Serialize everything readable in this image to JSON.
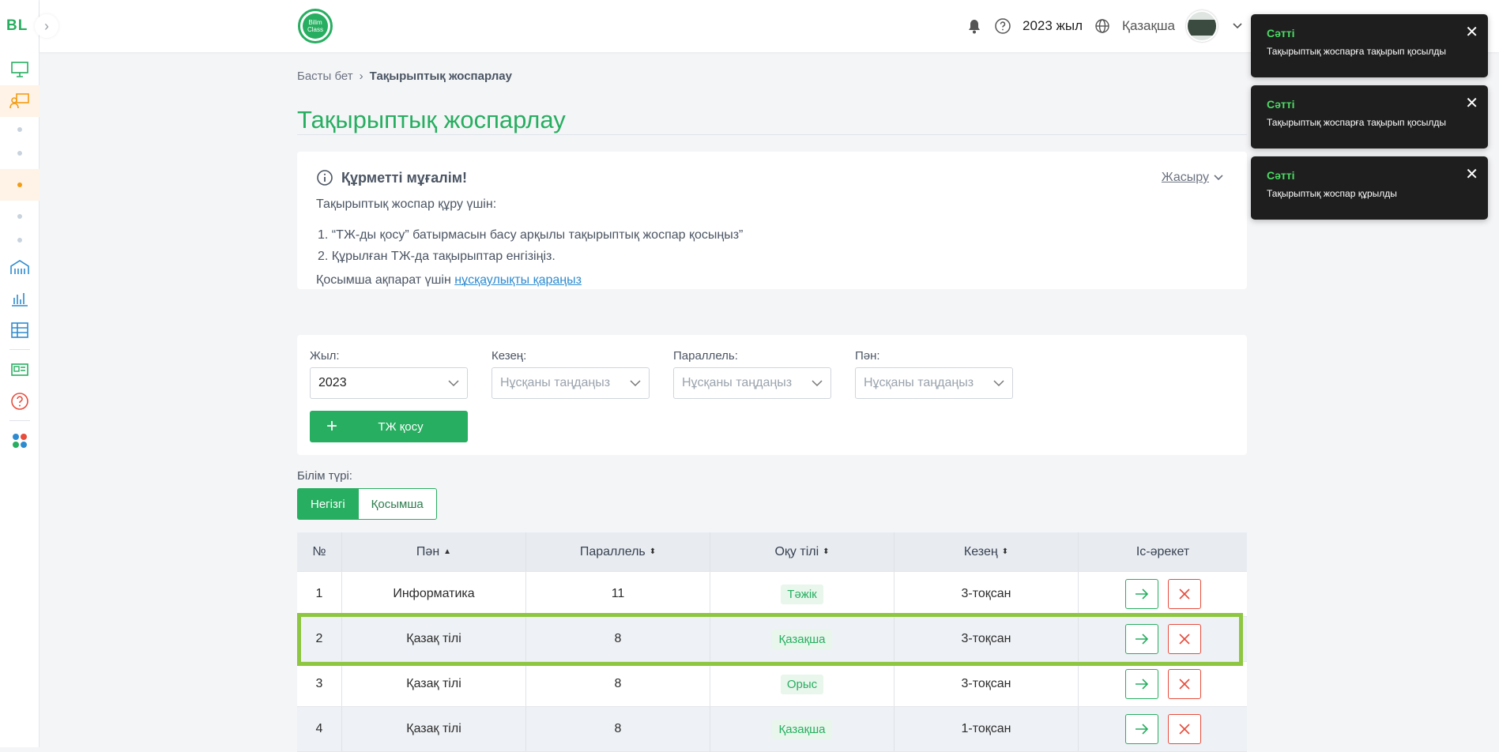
{
  "sidebar": {
    "logo": "BL",
    "collapse_icon": "chevron-right-icon"
  },
  "topbar": {
    "brand_text": "Bilim Class",
    "year": "2023 жыл",
    "language": "Қазақша"
  },
  "breadcrumb": {
    "home": "Басты бет",
    "current": "Тақырыптық жоспарлау"
  },
  "page_title": "Тақырыптық жоспарлау",
  "info": {
    "heading": "Құрметті мұғалім!",
    "hide_label": "Жасыру",
    "intro": "Тақырыптық жоспар құру үшін:",
    "steps": [
      "1. “ТЖ-ды қосу” батырмасын басу арқылы тақырыптық жоспар қосыңыз”",
      "2. Құрылған ТЖ-да тақырыптар енгізіңіз."
    ],
    "more_prefix": "Қосымша ақпарат үшін ",
    "more_link": "нұсқаулықты қараңыз"
  },
  "filters": {
    "year_label": "Жыл:",
    "year_value": "2023",
    "period_label": "Кезең:",
    "period_placeholder": "Нұсқаны таңдаңыз",
    "parallel_label": "Параллель:",
    "parallel_placeholder": "Нұсқаны таңдаңыз",
    "subject_label": "Пән:",
    "subject_placeholder": "Нұсқаны таңдаңыз",
    "add_button": "ТЖ қосу"
  },
  "edu_type": {
    "label": "Білім түрі:",
    "options": [
      "Негізгі",
      "Қосымша"
    ],
    "selected": "Негізгі"
  },
  "table": {
    "headers": [
      "№",
      "Пән",
      "Параллель",
      "Оқу тілі",
      "Кезең",
      "Іс-әрекет"
    ],
    "rows": [
      {
        "num": "1",
        "subject": "Информатика",
        "parallel": "11",
        "language": "Тәжік",
        "period": "3-тоқсан"
      },
      {
        "num": "2",
        "subject": "Қазақ тілі",
        "parallel": "8",
        "language": "Қазақша",
        "period": "3-тоқсан"
      },
      {
        "num": "3",
        "subject": "Қазақ тілі",
        "parallel": "8",
        "language": "Орыс",
        "period": "3-тоқсан"
      },
      {
        "num": "4",
        "subject": "Қазақ тілі",
        "parallel": "8",
        "language": "Қазақша",
        "period": "1-тоқсан"
      }
    ]
  },
  "toasts": [
    {
      "title": "Сәтті",
      "message": "Тақырыптық жоспарға тақырып қосылды"
    },
    {
      "title": "Сәтті",
      "message": "Тақырыптық жоспарға тақырып қосылды"
    },
    {
      "title": "Сәтті",
      "message": "Тақырыптық жоспар құрылды"
    }
  ],
  "colors": {
    "brand_green": "#27ae60",
    "danger_red": "#e74c3c",
    "highlight": "#8dc63f",
    "toast_bg": "#1e1e1e"
  }
}
